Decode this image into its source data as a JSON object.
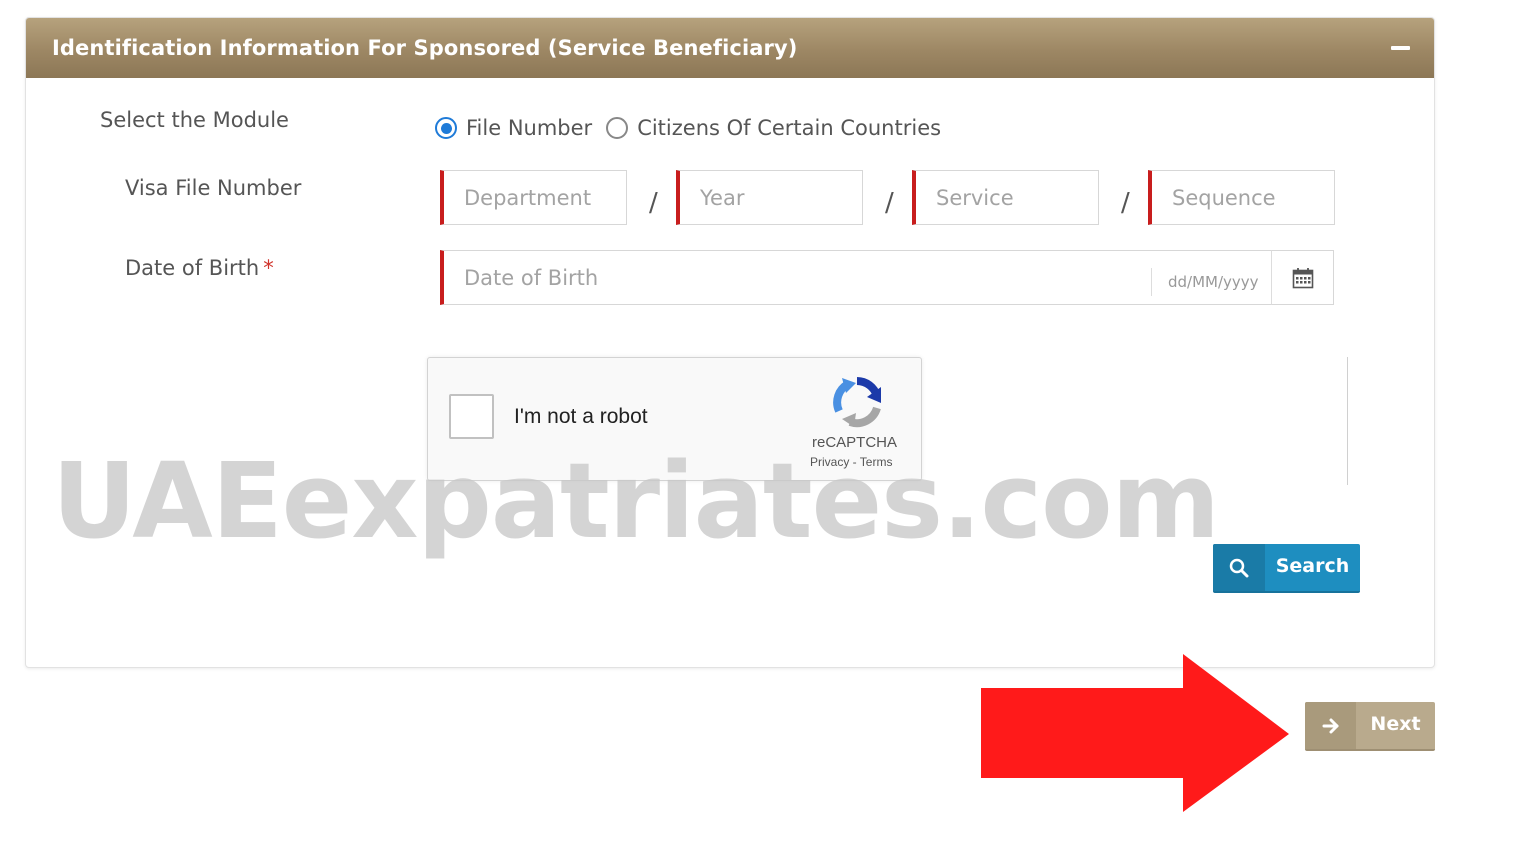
{
  "panel": {
    "title": "Identification Information For Sponsored (Service Beneficiary)"
  },
  "form": {
    "module_label": "Select the Module",
    "module_options": [
      "File Number",
      "Citizens Of Certain Countries"
    ],
    "module_selected": "File Number",
    "visa_label": "Visa File Number",
    "visa_fields": {
      "department_placeholder": "Department",
      "year_placeholder": "Year",
      "service_placeholder": "Service",
      "sequence_placeholder": "Sequence"
    },
    "separator": "/",
    "dob_label": "Date of Birth",
    "required_mark": "*",
    "dob_placeholder": "Date of Birth",
    "dob_format": "dd/MM/yyyy"
  },
  "captcha": {
    "label": "I'm not a robot",
    "brand": "reCAPTCHA",
    "privacy": "Privacy",
    "link_separator": " - ",
    "terms": "Terms"
  },
  "buttons": {
    "search": "Search",
    "next": "Next"
  },
  "watermark": "UAEexpatriates.com",
  "colors": {
    "header": "#9d8764",
    "required_border": "#c81d1d",
    "search_button": "#1e8ec0",
    "next_button": "#b9aa8d",
    "radio_selected": "#1f7bd8",
    "annotation_arrow": "#ff1a1a"
  },
  "icons": {
    "collapse": "minus-icon",
    "calendar": "calendar-icon",
    "search": "search-icon",
    "next": "arrow-right-icon",
    "captcha": "recaptcha-logo-icon"
  }
}
